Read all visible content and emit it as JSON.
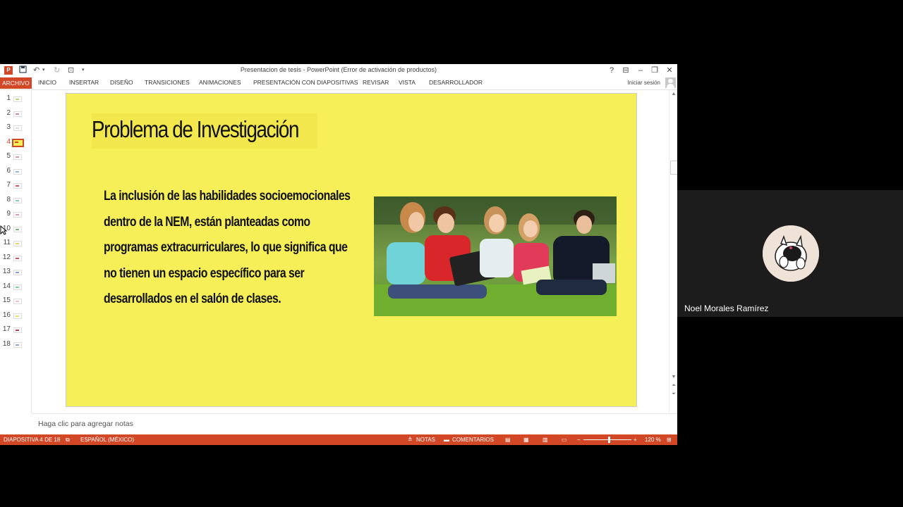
{
  "window": {
    "title": "Presentacion de tesis  - PowerPoint (Error de activación de productos)",
    "help": "?",
    "sign_in": "Iniciar sesión"
  },
  "ribbon_tabs": [
    "ARCHIVO",
    "INICIO",
    "INSERTAR",
    "DISEÑO",
    "TRANSICIONES",
    "ANIMACIONES",
    "PRESENTACIÓN CON DIAPOSITIVAS",
    "REVISAR",
    "VISTA",
    "DESARROLLADOR"
  ],
  "thumbnails": [
    {
      "num": "1",
      "color": "#b7d77a"
    },
    {
      "num": "2",
      "color": "#c98aa5"
    },
    {
      "num": "3",
      "color": "#dddddd"
    },
    {
      "num": "4",
      "color": "#d24726"
    },
    {
      "num": "5",
      "color": "#c9a0b0"
    },
    {
      "num": "6",
      "color": "#9ab7d6"
    },
    {
      "num": "7",
      "color": "#d06060"
    },
    {
      "num": "8",
      "color": "#8fc8b0"
    },
    {
      "num": "9",
      "color": "#d79ab8"
    },
    {
      "num": "10",
      "color": "#7fb27f"
    },
    {
      "num": "11",
      "color": "#e8d36a"
    },
    {
      "num": "12",
      "color": "#c05a6a"
    },
    {
      "num": "13",
      "color": "#8aa0d0"
    },
    {
      "num": "14",
      "color": "#7fc89a"
    },
    {
      "num": "15",
      "color": "#f0c0c8"
    },
    {
      "num": "16",
      "color": "#e8e070"
    },
    {
      "num": "17",
      "color": "#b04058"
    },
    {
      "num": "18",
      "color": "#9aa6d8"
    }
  ],
  "selected_slide": "4",
  "slide": {
    "title": "Problema de Investigación",
    "body_lines": [
      "La inclusión de las habilidades socioemocionales",
      "dentro de la NEM, están planteadas como",
      "programas extracurriculares, lo que significa que",
      "no tienen un espacio específico para ser",
      "desarrollados en el salón de clases."
    ],
    "background_color": "#f6ef58"
  },
  "notes_placeholder": "Haga clic para agregar notas",
  "status": {
    "slide_counter": "DIAPOSITIVA 4 DE 18",
    "language": "ESPAÑOL (MÉXICO)",
    "notes": "NOTAS",
    "comments": "COMENTARIOS",
    "zoom": "120 %",
    "zoom_minus": "−",
    "zoom_plus": "+"
  },
  "meeting": {
    "participant_name": "Noel Morales Ramírez"
  },
  "accent_color": "#d24726"
}
